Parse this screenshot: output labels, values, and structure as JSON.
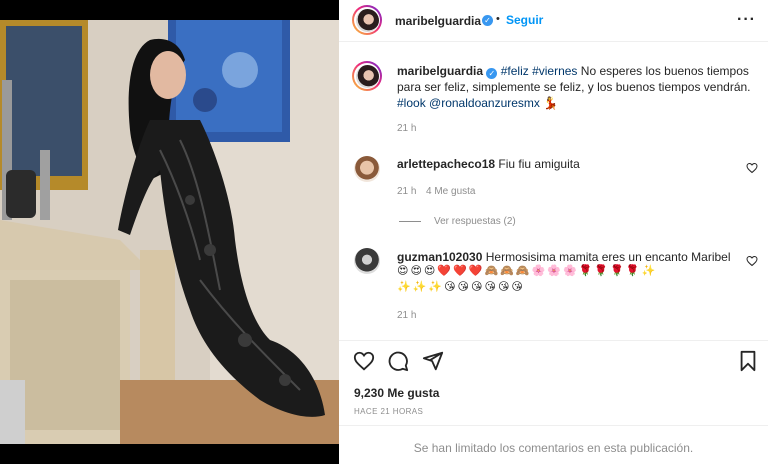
{
  "post": {
    "username": "maribelguardia",
    "follow_label": "Seguir",
    "caption": {
      "hashtag_1": "#feliz",
      "hashtag_2": "#viernes",
      "text": "No esperes los buenos tiempos para ser feliz, simplemente se feliz, y los buenos tiempos vendrán.",
      "hashtag_3": "#look",
      "mention": "@ronaldoanzuresmx",
      "emoji": "💃",
      "time": "21 h"
    },
    "likes": "9,230 Me gusta",
    "posted_ago": "HACE 21 HORAS",
    "comments_limited": "Se han limitado los comentarios en esta publicación."
  },
  "comments": [
    {
      "username": "arlettepacheco18",
      "text": "Fiu fiu amiguita",
      "time": "21 h",
      "likes": "4 Me gusta",
      "view_replies": "Ver respuestas (2)"
    },
    {
      "username": "guzman102030",
      "text": "Hermosisima mamita eres un encanto Maribel",
      "emoji_line_1": "😍😍😍❤️❤️❤️🙈🙈🙈🌸🌸🌸🌹🌹🌹🌹✨",
      "emoji_line_2": "✨✨✨😘😘😘😘😘😘",
      "time": "21 h"
    }
  ],
  "icons": {
    "verified": "verified-badge-icon",
    "more": "more-options-icon",
    "like": "heart-icon",
    "comment": "comment-icon",
    "share": "share-icon",
    "save": "bookmark-icon"
  },
  "colors": {
    "link": "#0095f6",
    "tag": "#00376b",
    "muted": "#8e8e8e",
    "text": "#262626"
  }
}
